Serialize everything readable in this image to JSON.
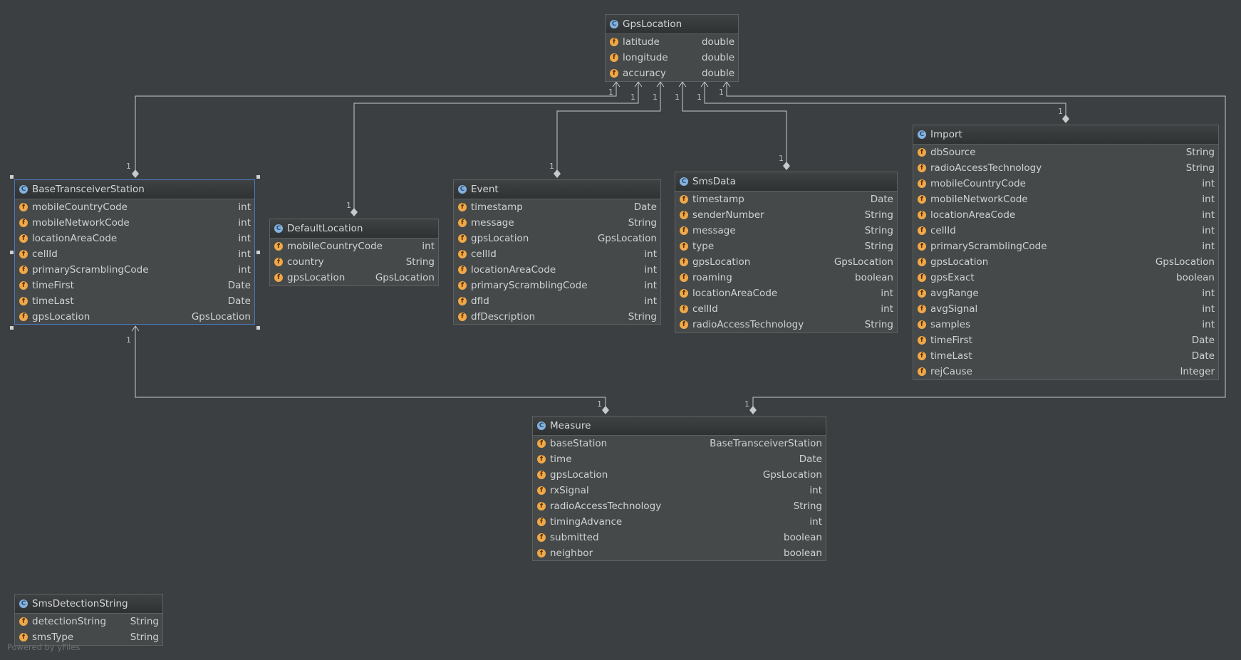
{
  "icons": {
    "class_icon": "C",
    "field_icon": "f"
  },
  "classes": {
    "gpsLocation": {
      "name": "GpsLocation",
      "fields": [
        {
          "name": "latitude",
          "type": "double"
        },
        {
          "name": "longitude",
          "type": "double"
        },
        {
          "name": "accuracy",
          "type": "double"
        }
      ]
    },
    "baseTransceiverStation": {
      "name": "BaseTransceiverStation",
      "fields": [
        {
          "name": "mobileCountryCode",
          "type": "int"
        },
        {
          "name": "mobileNetworkCode",
          "type": "int"
        },
        {
          "name": "locationAreaCode",
          "type": "int"
        },
        {
          "name": "cellId",
          "type": "int"
        },
        {
          "name": "primaryScramblingCode",
          "type": "int"
        },
        {
          "name": "timeFirst",
          "type": "Date"
        },
        {
          "name": "timeLast",
          "type": "Date"
        },
        {
          "name": "gpsLocation",
          "type": "GpsLocation"
        }
      ]
    },
    "defaultLocation": {
      "name": "DefaultLocation",
      "fields": [
        {
          "name": "mobileCountryCode",
          "type": "int"
        },
        {
          "name": "country",
          "type": "String"
        },
        {
          "name": "gpsLocation",
          "type": "GpsLocation"
        }
      ]
    },
    "event": {
      "name": "Event",
      "fields": [
        {
          "name": "timestamp",
          "type": "Date"
        },
        {
          "name": "message",
          "type": "String"
        },
        {
          "name": "gpsLocation",
          "type": "GpsLocation"
        },
        {
          "name": "cellId",
          "type": "int"
        },
        {
          "name": "locationAreaCode",
          "type": "int"
        },
        {
          "name": "primaryScramblingCode",
          "type": "int"
        },
        {
          "name": "dfId",
          "type": "int"
        },
        {
          "name": "dfDescription",
          "type": "String"
        }
      ]
    },
    "smsData": {
      "name": "SmsData",
      "fields": [
        {
          "name": "timestamp",
          "type": "Date"
        },
        {
          "name": "senderNumber",
          "type": "String"
        },
        {
          "name": "message",
          "type": "String"
        },
        {
          "name": "type",
          "type": "String"
        },
        {
          "name": "gpsLocation",
          "type": "GpsLocation"
        },
        {
          "name": "roaming",
          "type": "boolean"
        },
        {
          "name": "locationAreaCode",
          "type": "int"
        },
        {
          "name": "cellId",
          "type": "int"
        },
        {
          "name": "radioAccessTechnology",
          "type": "String"
        }
      ]
    },
    "import": {
      "name": "Import",
      "fields": [
        {
          "name": "dbSource",
          "type": "String"
        },
        {
          "name": "radioAccessTechnology",
          "type": "String"
        },
        {
          "name": "mobileCountryCode",
          "type": "int"
        },
        {
          "name": "mobileNetworkCode",
          "type": "int"
        },
        {
          "name": "locationAreaCode",
          "type": "int"
        },
        {
          "name": "cellId",
          "type": "int"
        },
        {
          "name": "primaryScramblingCode",
          "type": "int"
        },
        {
          "name": "gpsLocation",
          "type": "GpsLocation"
        },
        {
          "name": "gpsExact",
          "type": "boolean"
        },
        {
          "name": "avgRange",
          "type": "int"
        },
        {
          "name": "avgSignal",
          "type": "int"
        },
        {
          "name": "samples",
          "type": "int"
        },
        {
          "name": "timeFirst",
          "type": "Date"
        },
        {
          "name": "timeLast",
          "type": "Date"
        },
        {
          "name": "rejCause",
          "type": "Integer"
        }
      ]
    },
    "measure": {
      "name": "Measure",
      "fields": [
        {
          "name": "baseStation",
          "type": "BaseTransceiverStation"
        },
        {
          "name": "time",
          "type": "Date"
        },
        {
          "name": "gpsLocation",
          "type": "GpsLocation"
        },
        {
          "name": "rxSignal",
          "type": "int"
        },
        {
          "name": "radioAccessTechnology",
          "type": "String"
        },
        {
          "name": "timingAdvance",
          "type": "int"
        },
        {
          "name": "submitted",
          "type": "boolean"
        },
        {
          "name": "neighbor",
          "type": "boolean"
        }
      ]
    },
    "smsDetectionString": {
      "name": "SmsDetectionString",
      "fields": [
        {
          "name": "detectionString",
          "type": "String"
        },
        {
          "name": "smsType",
          "type": "String"
        }
      ]
    }
  },
  "relationships": [
    {
      "from": "BaseTransceiverStation",
      "to": "GpsLocation",
      "from_multiplicity": "1",
      "to_multiplicity": "1"
    },
    {
      "from": "DefaultLocation",
      "to": "GpsLocation",
      "from_multiplicity": "1",
      "to_multiplicity": "1"
    },
    {
      "from": "Event",
      "to": "GpsLocation",
      "from_multiplicity": "1",
      "to_multiplicity": "1"
    },
    {
      "from": "SmsData",
      "to": "GpsLocation",
      "from_multiplicity": "1",
      "to_multiplicity": "1"
    },
    {
      "from": "Import",
      "to": "GpsLocation",
      "from_multiplicity": "1",
      "to_multiplicity": "1"
    },
    {
      "from": "Measure",
      "to": "GpsLocation",
      "from_multiplicity": "1",
      "to_multiplicity": "1"
    },
    {
      "from": "Measure",
      "to": "BaseTransceiverStation",
      "from_multiplicity": "1",
      "to_multiplicity": "1"
    }
  ],
  "footer": "Powered by yFiles",
  "colors": {
    "background": "#3c3f41",
    "edge": "#c7c9cb",
    "selection": "#4a78c2",
    "class_icon": "#84b2de",
    "field_icon": "#f0a848"
  }
}
